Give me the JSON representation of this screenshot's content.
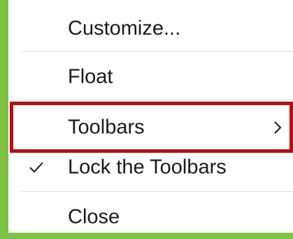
{
  "menu": {
    "items": [
      {
        "label": "Customize...",
        "checked": false,
        "submenu": false
      },
      {
        "label": "Float",
        "checked": false,
        "submenu": false
      },
      {
        "label": "Toolbars",
        "checked": false,
        "submenu": true
      },
      {
        "label": "Lock the Toolbars",
        "checked": true,
        "submenu": false
      },
      {
        "label": "Close",
        "checked": false,
        "submenu": false
      }
    ],
    "icons": {
      "check": "checkmark-icon",
      "submenu": "chevron-right-icon"
    }
  },
  "colors": {
    "background": "#7dc243",
    "menu_background": "#ffffff",
    "highlight_border": "#b30f14",
    "separator": "#e3e3e3",
    "text": "#1a1a1a"
  }
}
